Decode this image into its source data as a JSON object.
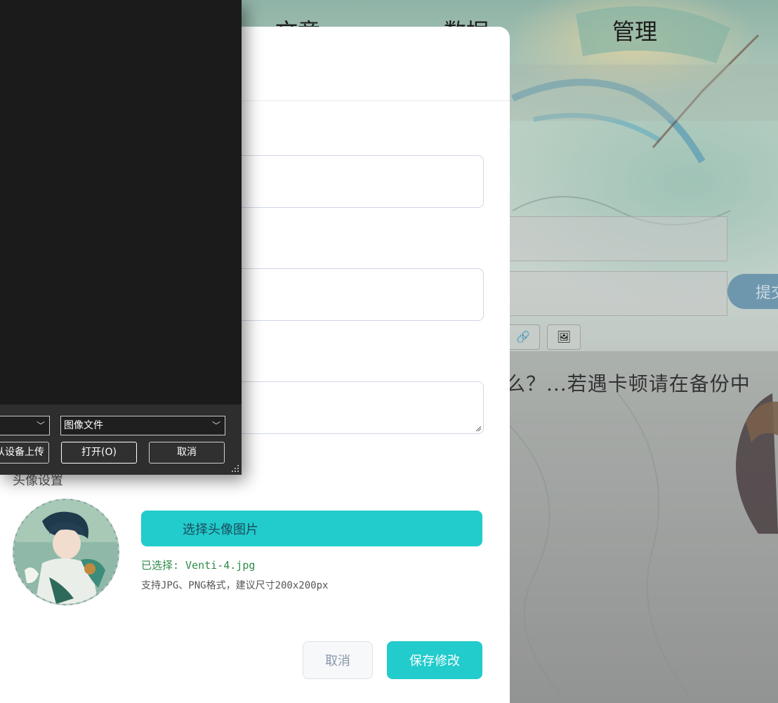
{
  "background": {
    "nav": {
      "item_articles": "文章",
      "item_data": "数据",
      "item_manage": "管理"
    },
    "submit_label": "提交",
    "toolbar": [
      "link-icon",
      "image-icon"
    ],
    "notice": "么？...若遇卡顿请在备份中"
  },
  "modal": {
    "avatar_section_label": "头像设置",
    "choose_avatar_label": "选择头像图片",
    "selected_file_text": "已选择: Venti-4.jpg",
    "hint_text": "支持JPG、PNG格式，建议尺寸200x200px",
    "cancel_label": "取消",
    "save_label": "保存修改"
  },
  "file_dialog": {
    "source_value": "",
    "file_type_value": "图像文件",
    "upload_from_device_label": "从设备上传",
    "open_label": "打开(O)",
    "cancel_label": "取消"
  },
  "colors": {
    "accent": "#22cbcc",
    "dialog_bg": "#1b1b1b",
    "success_text": "#2f8a4a"
  }
}
